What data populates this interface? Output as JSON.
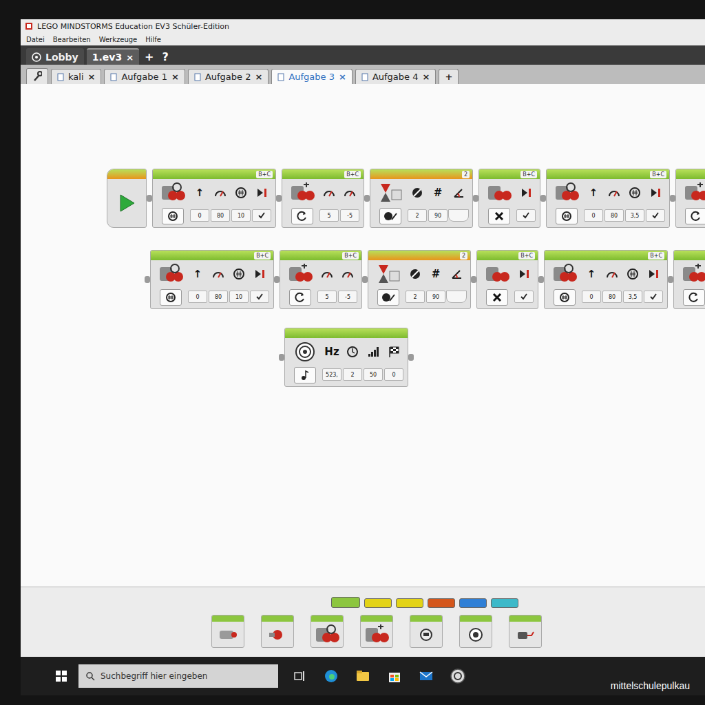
{
  "window": {
    "title": "LEGO MINDSTORMS Education EV3 Schüler-Edition"
  },
  "menu": [
    "Datei",
    "Bearbeiten",
    "Werkzeuge",
    "Hilfe"
  ],
  "close_glyph": "×",
  "project_tabs": [
    {
      "label": "Lobby",
      "selected": false,
      "closable": false
    },
    {
      "label": "1.ev3",
      "selected": true,
      "closable": true
    }
  ],
  "project_actions": [
    "+",
    "?"
  ],
  "program_tabs": [
    {
      "label": "kali",
      "selected": false
    },
    {
      "label": "Aufgabe 1",
      "selected": false
    },
    {
      "label": "Aufgabe 2",
      "selected": false
    },
    {
      "label": "Aufgabe 3",
      "selected": true
    },
    {
      "label": "Aufgabe 4",
      "selected": false
    }
  ],
  "add_tab_glyph": "+",
  "program": {
    "rows": [
      {
        "blocks": [
          {
            "kind": "start",
            "port": "",
            "params": []
          },
          {
            "kind": "move-steering",
            "port": "B+C",
            "params": [
              {
                "kind": "glyph",
                "glyph": "↑",
                "value": "0"
              },
              {
                "kind": "gauge",
                "value": "80"
              },
              {
                "kind": "rotations",
                "value": "10"
              },
              {
                "kind": "brake",
                "checked": true
              }
            ]
          },
          {
            "kind": "move-tank",
            "port": "B+C",
            "params": [
              {
                "kind": "gauge",
                "value": "5"
              },
              {
                "kind": "gauge",
                "value": "-5"
              }
            ]
          },
          {
            "kind": "wait",
            "port": "2",
            "params": [
              {
                "kind": "compare",
                "value": "2"
              },
              {
                "kind": "glyph",
                "glyph": "#",
                "value": "90"
              },
              {
                "kind": "angle",
                "output": true
              }
            ]
          },
          {
            "kind": "motor-stop",
            "port": "B+C",
            "params": [
              {
                "kind": "brake",
                "checked": true
              }
            ]
          },
          {
            "kind": "move-steering",
            "port": "B+C",
            "params": [
              {
                "kind": "glyph",
                "glyph": "↑",
                "value": "0"
              },
              {
                "kind": "gauge",
                "value": "80"
              },
              {
                "kind": "rotations",
                "value": "3,5"
              },
              {
                "kind": "brake",
                "checked": true
              }
            ]
          },
          {
            "kind": "move-tank",
            "port": "",
            "params": []
          }
        ]
      },
      {
        "blocks": [
          {
            "kind": "move-steering",
            "port": "B+C",
            "params": [
              {
                "kind": "glyph",
                "glyph": "↑",
                "value": "0"
              },
              {
                "kind": "gauge",
                "value": "80"
              },
              {
                "kind": "rotations",
                "value": "10"
              },
              {
                "kind": "brake",
                "checked": true
              }
            ]
          },
          {
            "kind": "move-tank",
            "port": "B+C",
            "params": [
              {
                "kind": "gauge",
                "value": "5"
              },
              {
                "kind": "gauge",
                "value": "-5"
              }
            ]
          },
          {
            "kind": "wait",
            "port": "2",
            "params": [
              {
                "kind": "compare",
                "value": "2"
              },
              {
                "kind": "glyph",
                "glyph": "#",
                "value": "90"
              },
              {
                "kind": "angle",
                "output": true
              }
            ]
          },
          {
            "kind": "motor-stop",
            "port": "B+C",
            "params": [
              {
                "kind": "brake",
                "checked": true
              }
            ]
          },
          {
            "kind": "move-steering",
            "port": "B+C",
            "params": [
              {
                "kind": "glyph",
                "glyph": "↑",
                "value": "0"
              },
              {
                "kind": "gauge",
                "value": "80"
              },
              {
                "kind": "rotations",
                "value": "3,5"
              },
              {
                "kind": "brake",
                "checked": true
              }
            ]
          },
          {
            "kind": "move-tank",
            "port": "",
            "params": []
          }
        ]
      },
      {
        "blocks": [
          {
            "kind": "sound",
            "port": "",
            "params": [
              {
                "kind": "glyph",
                "glyph": "Hz",
                "value": "523,"
              },
              {
                "kind": "clock",
                "value": "2"
              },
              {
                "kind": "volume",
                "value": "50"
              },
              {
                "kind": "flag",
                "value": "0"
              }
            ]
          }
        ]
      }
    ]
  },
  "palette": {
    "tabs": [
      {
        "color": "#8cc63f",
        "selected": true
      },
      {
        "color": "#e3d316",
        "selected": false
      },
      {
        "color": "#e3d316",
        "selected": false
      },
      {
        "color": "#d4561b",
        "selected": false
      },
      {
        "color": "#2f7fd6",
        "selected": false
      },
      {
        "color": "#3cb9c9",
        "selected": false
      }
    ],
    "blocks": [
      {
        "kind": "medium-motor"
      },
      {
        "kind": "large-motor"
      },
      {
        "kind": "move-steering"
      },
      {
        "kind": "move-tank"
      },
      {
        "kind": "display"
      },
      {
        "kind": "sound"
      },
      {
        "kind": "brick-light"
      }
    ]
  },
  "taskbar": {
    "search_placeholder": "Suchbegriff hier eingeben",
    "apps": [
      {
        "kind": "task-view"
      },
      {
        "kind": "edge"
      },
      {
        "kind": "explorer"
      },
      {
        "kind": "store"
      },
      {
        "kind": "mail"
      },
      {
        "kind": "ev3"
      }
    ]
  },
  "watermark": "mittelschulepulkau"
}
